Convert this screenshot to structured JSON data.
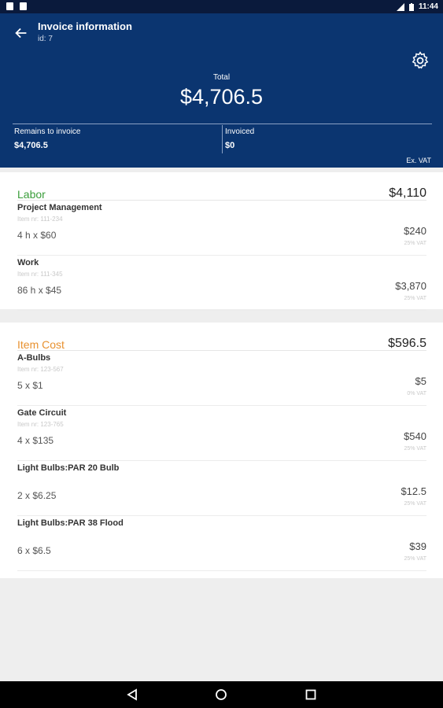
{
  "status": {
    "time": "11:44"
  },
  "header": {
    "title": "Invoice information",
    "subtitle": "id: 7",
    "total_label": "Total",
    "total_value": "$4,706.5",
    "remains_label": "Remains to invoice",
    "remains_value": "$4,706.5",
    "invoiced_label": "Invoiced",
    "invoiced_value": "$0",
    "vat_note": "Ex. VAT"
  },
  "sections": [
    {
      "title": "Labor",
      "color": "#3a9d3a",
      "total": "$4,110",
      "items": [
        {
          "name": "Project Management",
          "item_nr": "Item nr: 111-234",
          "qty": "4 h x $60",
          "amount": "$240",
          "vat": "25% VAT"
        },
        {
          "name": "Work",
          "item_nr": "Item nr: 111-345",
          "qty": "86 h x $45",
          "amount": "$3,870",
          "vat": "25% VAT"
        }
      ]
    },
    {
      "title": "Item Cost",
      "color": "#e8912f",
      "total": "$596.5",
      "items": [
        {
          "name": "A-Bulbs",
          "item_nr": "Item nr: 123-567",
          "qty": "5 x $1",
          "amount": "$5",
          "vat": "0% VAT"
        },
        {
          "name": "Gate Circuit",
          "item_nr": "Item nr: 123-765",
          "qty": "4 x $135",
          "amount": "$540",
          "vat": "25% VAT"
        },
        {
          "name": "Light Bulbs:PAR 20 Bulb",
          "item_nr": "",
          "qty": "2 x $6.25",
          "amount": "$12.5",
          "vat": "25% VAT"
        },
        {
          "name": "Light Bulbs:PAR 38 Flood",
          "item_nr": "",
          "qty": "6 x $6.5",
          "amount": "$39",
          "vat": "25% VAT"
        }
      ]
    }
  ]
}
